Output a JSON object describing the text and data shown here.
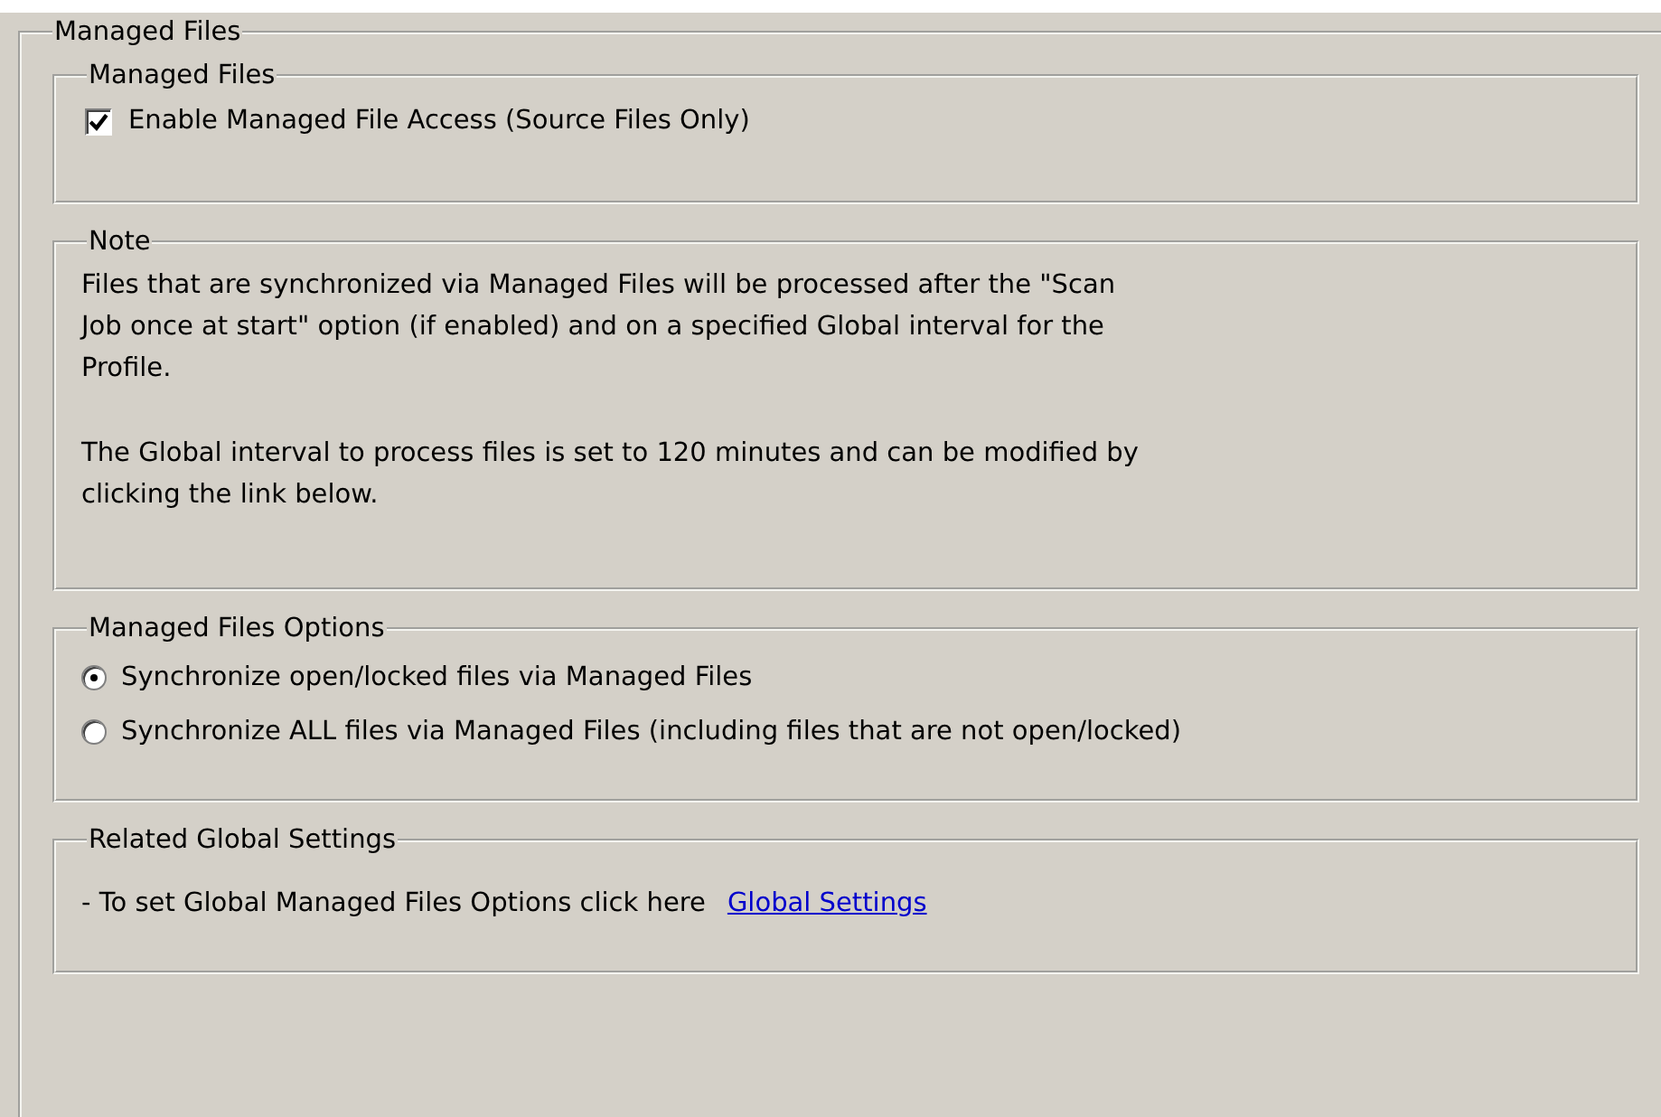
{
  "outer_group": {
    "title": "Managed Files"
  },
  "managed_files": {
    "title": "Managed Files",
    "checkbox": {
      "label": "Enable Managed File Access (Source Files Only)",
      "checked": true
    }
  },
  "note": {
    "title": "Note",
    "paragraphs": [
      "Files that are synchronized via Managed Files will be processed after the \"Scan\nJob once at start\" option (if enabled) and on a specified Global interval for the\nProfile.",
      "The Global interval to process files is set to 120 minutes and can be modified by\nclicking the link below."
    ]
  },
  "options": {
    "title": "Managed Files Options",
    "radios": [
      {
        "label": "Synchronize open/locked files via Managed Files",
        "selected": true
      },
      {
        "label": "Synchronize ALL files via Managed Files (including files that are not open/locked)",
        "selected": false
      }
    ]
  },
  "related": {
    "title": "Related Global Settings",
    "text": "- To set Global Managed Files Options click here",
    "link": "Global Settings"
  }
}
